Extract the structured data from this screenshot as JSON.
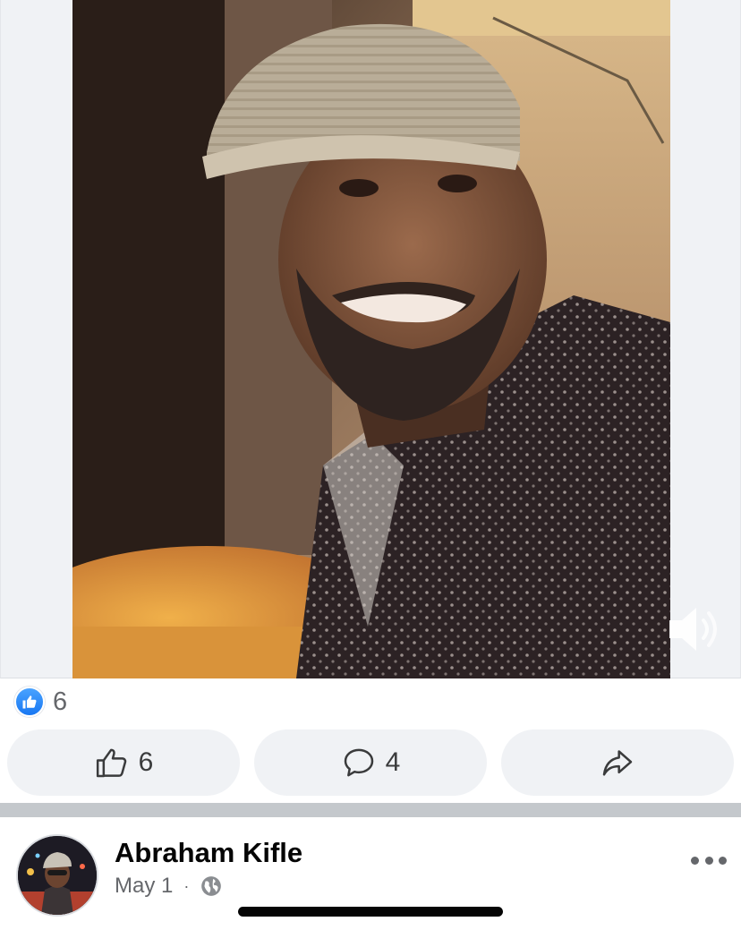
{
  "post_top": {
    "reactions": {
      "icon": "like-reaction-icon",
      "count": "6"
    },
    "actions": {
      "like": {
        "icon": "thumbs-up-outline-icon",
        "count": "6"
      },
      "comment": {
        "icon": "comment-bubble-icon",
        "count": "4"
      },
      "share": {
        "icon": "share-arrow-icon"
      }
    },
    "video": {
      "volume_icon": "speaker-volume-icon"
    }
  },
  "next_post": {
    "author": "Abraham Kifle",
    "date": "May 1",
    "separator": "·",
    "privacy_icon": "globe-icon",
    "menu_icon": "more-options-icon"
  },
  "colors": {
    "accent": "#1877f2",
    "button_bg": "#f0f2f5",
    "secondary_text": "#65676b",
    "primary_text": "#050505"
  }
}
